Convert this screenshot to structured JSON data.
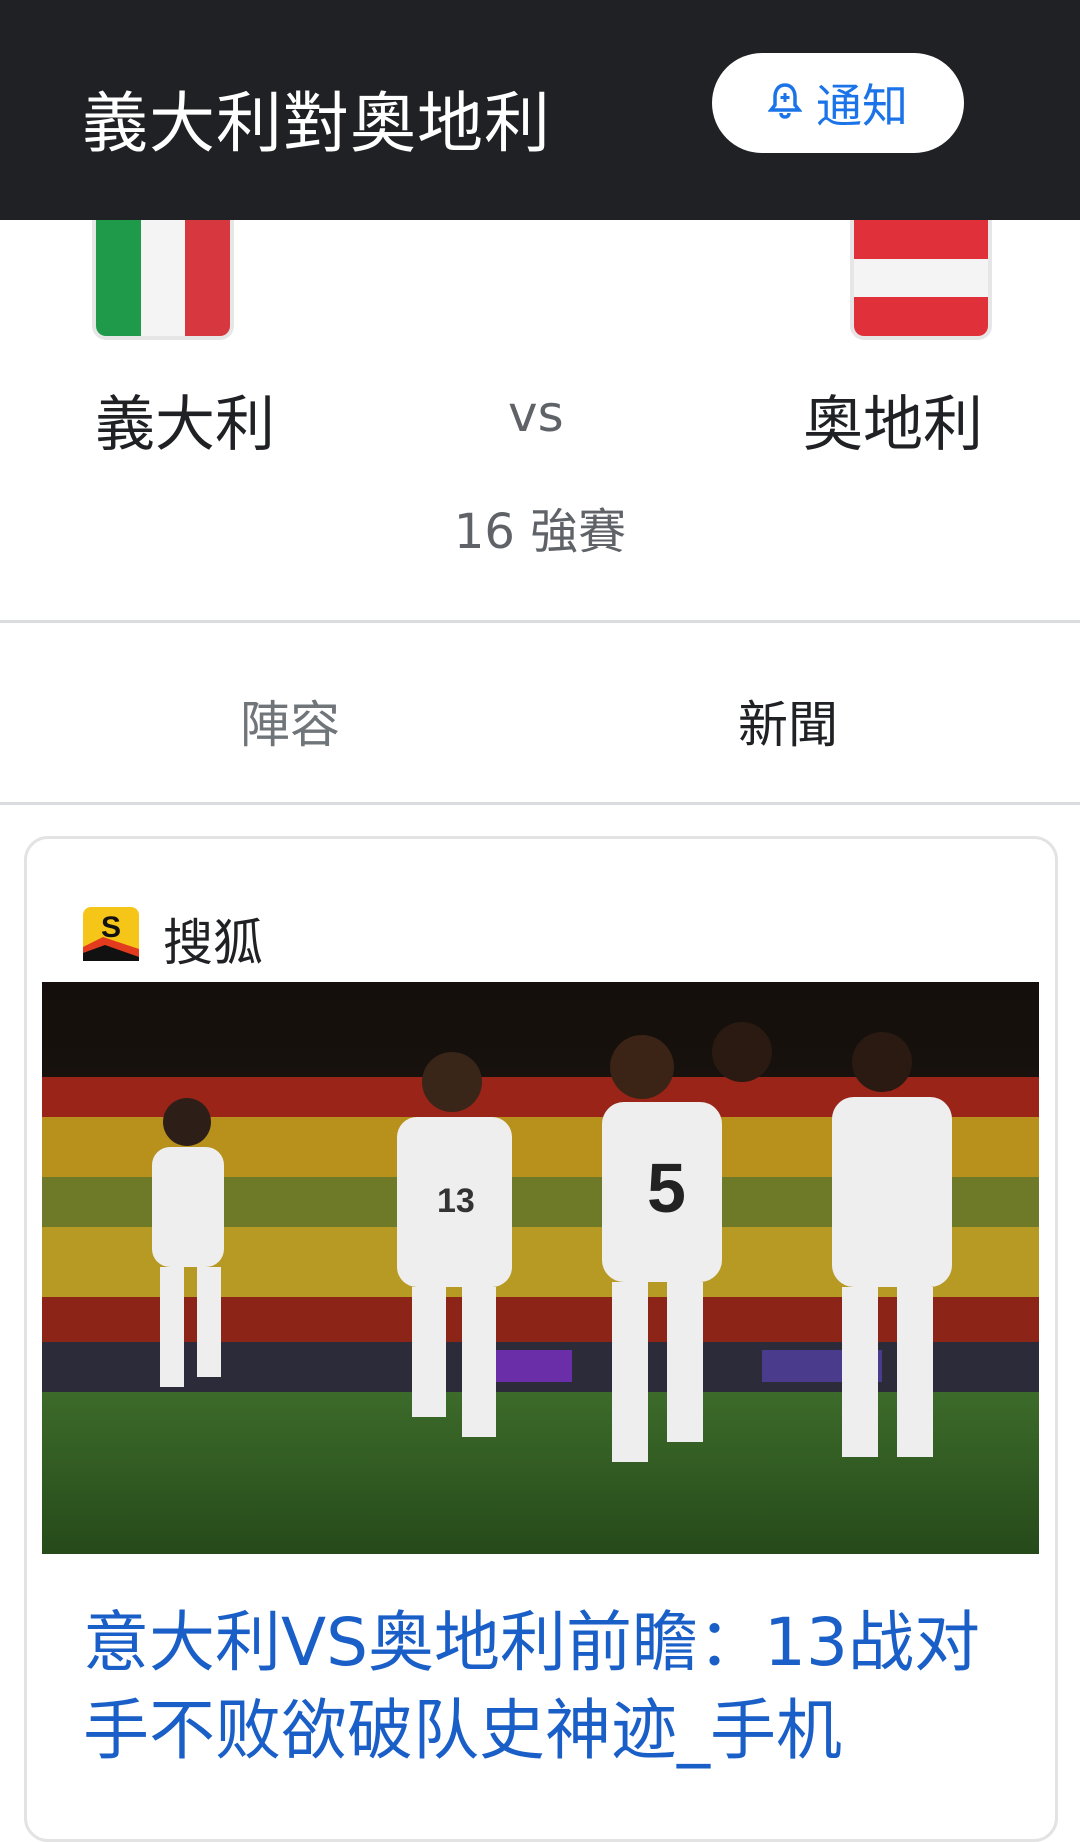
{
  "header": {
    "title": "義大利對奧地利",
    "notify_label": "通知"
  },
  "match": {
    "home_team": "義大利",
    "vs": "vs",
    "away_team": "奧地利",
    "stage": "16 強賽",
    "home_flag_colors": [
      "#1f9a4a",
      "#f4f4f4",
      "#d7373f"
    ],
    "away_flag_colors": [
      "#e0313b",
      "#f4f4f4",
      "#e0313b"
    ]
  },
  "tabs": [
    {
      "label": "陣容",
      "active": false
    },
    {
      "label": "新聞",
      "active": true
    }
  ],
  "news": {
    "source": "搜狐",
    "headline": "意大利VS奥地利前瞻：13战对手不败欲破队史神迹_手机"
  },
  "colors": {
    "link": "#1a5fc7",
    "topbar": "#202124",
    "accent": "#1a73e8"
  }
}
